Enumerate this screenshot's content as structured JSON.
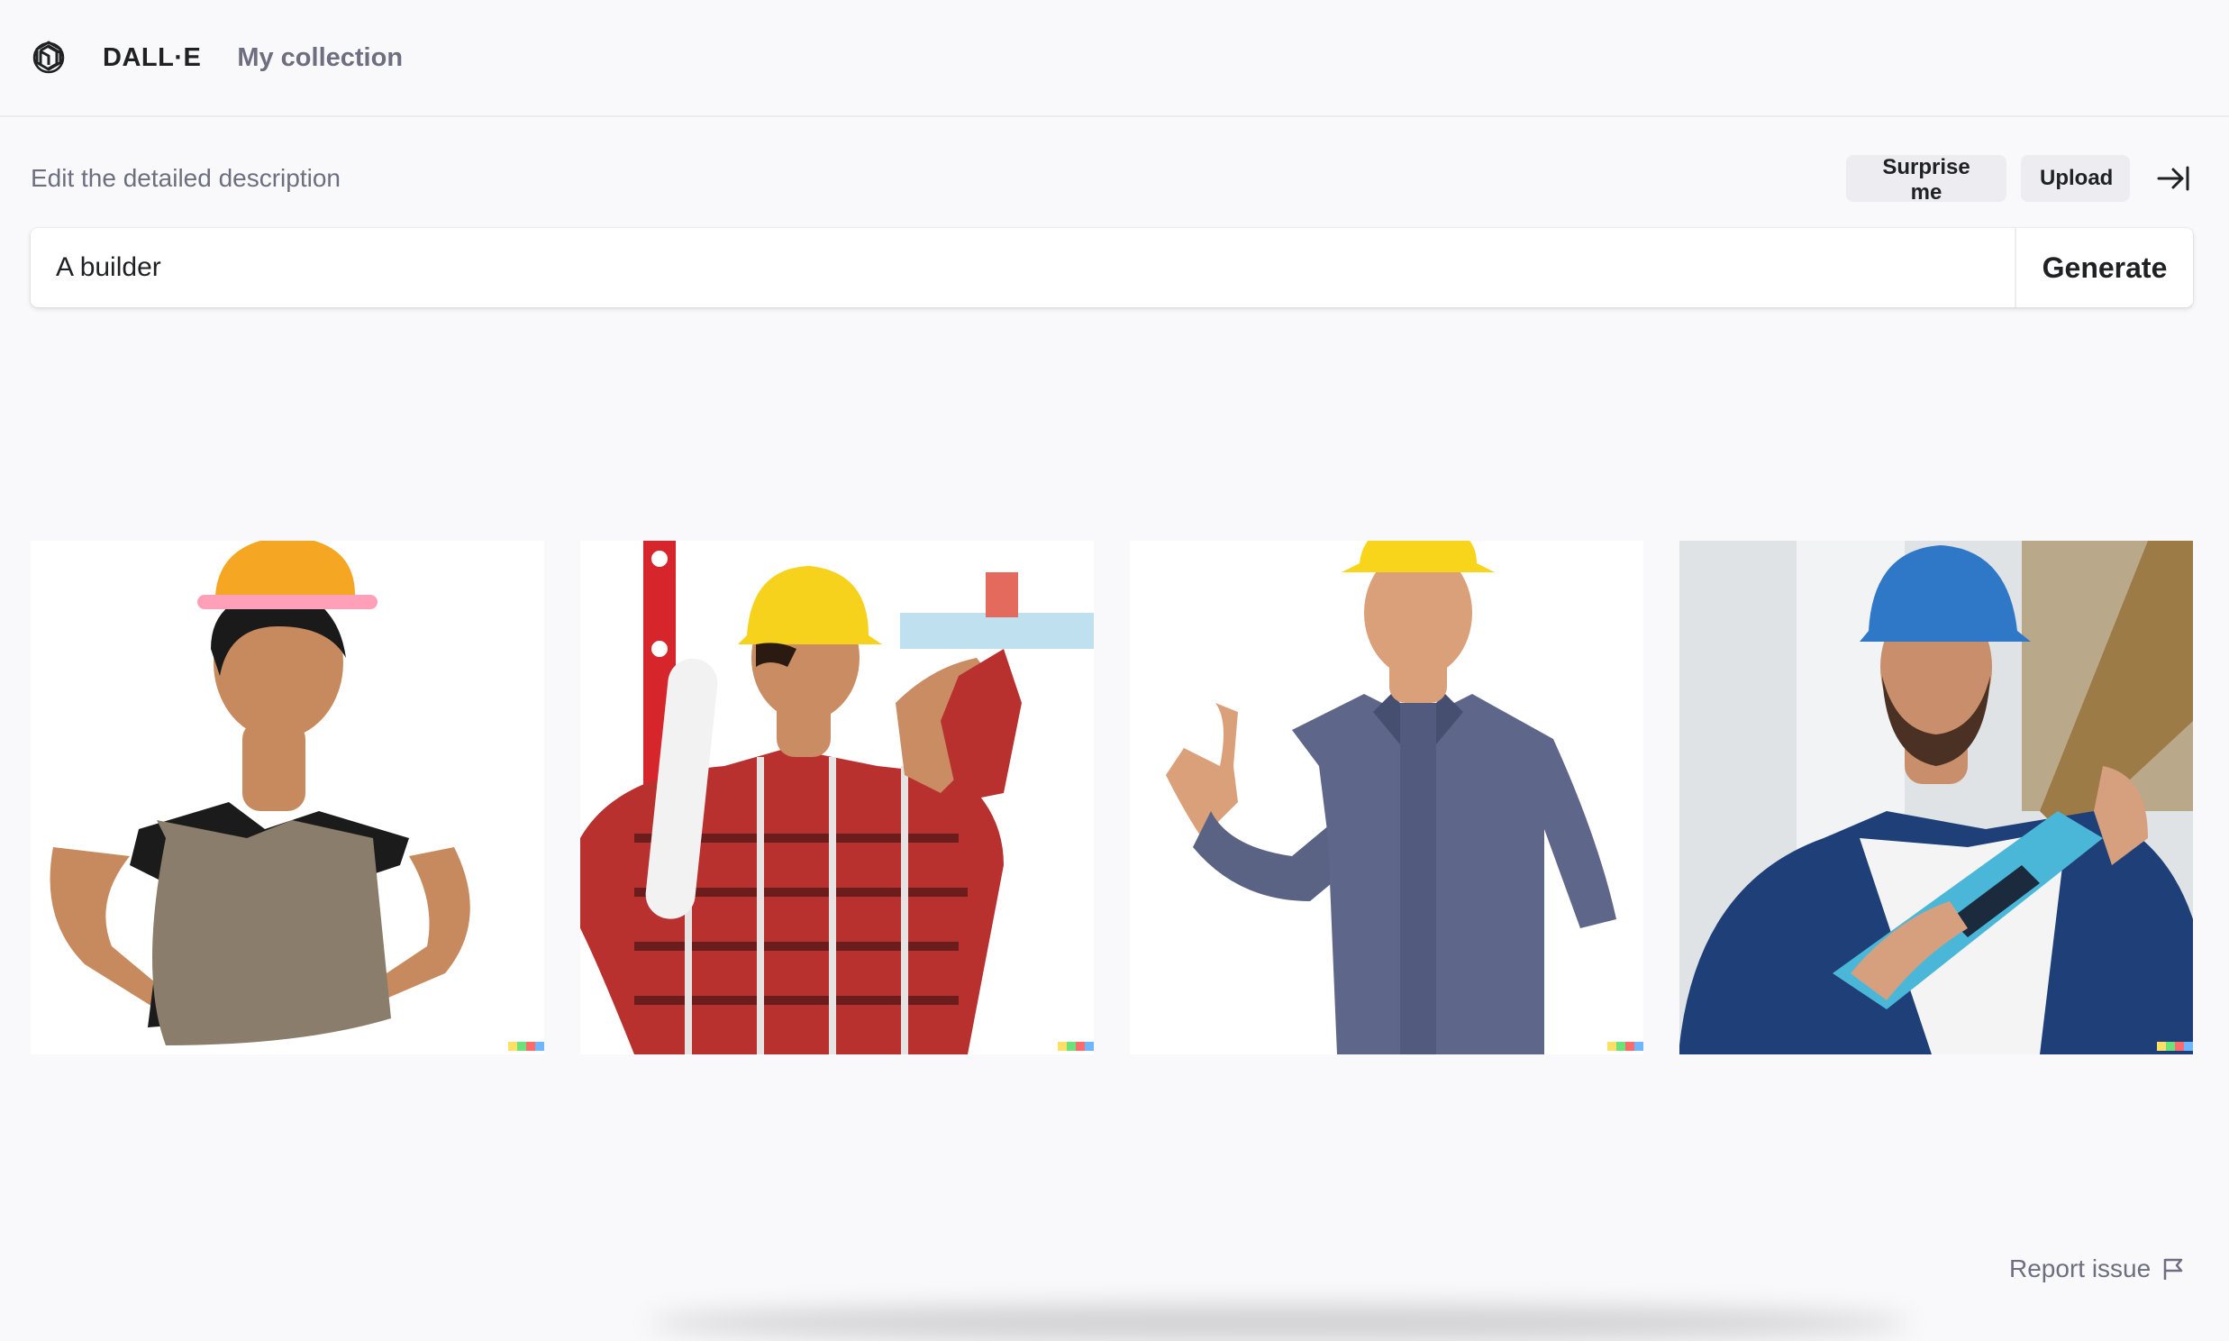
{
  "header": {
    "logo_icon": "openai-logo-icon",
    "brand": "DALL·E",
    "nav_link": "My collection"
  },
  "prompt_panel": {
    "hint": "Edit the detailed description",
    "surprise_label": "Surprise me",
    "upload_label": "Upload",
    "collapse_icon": "arrow-right-to-bar-icon",
    "prompt_value": "A builder",
    "generate_label": "Generate"
  },
  "results": {
    "images": [
      {
        "subject": "woman in orange hard hat and mesh vest, hands on hips",
        "hat_color": "#f5a623"
      },
      {
        "subject": "man in yellow hard hat and plaid shirt holding a level and rolled plans",
        "hat_color": "#f7d21c"
      },
      {
        "subject": "man in yellow hard hat and blue coveralls giving a thumbs up",
        "hat_color": "#f8d51b"
      },
      {
        "subject": "bearded man in blue hard hat holding a blue tool on a site",
        "hat_color": "#2f78c8"
      }
    ]
  },
  "footer": {
    "report_label": "Report issue",
    "report_icon": "flag-icon"
  },
  "colors": {
    "page_bg": "#f9f9fb",
    "text": "#202123",
    "muted": "#6e6e80",
    "pill_bg": "#ececf1"
  }
}
